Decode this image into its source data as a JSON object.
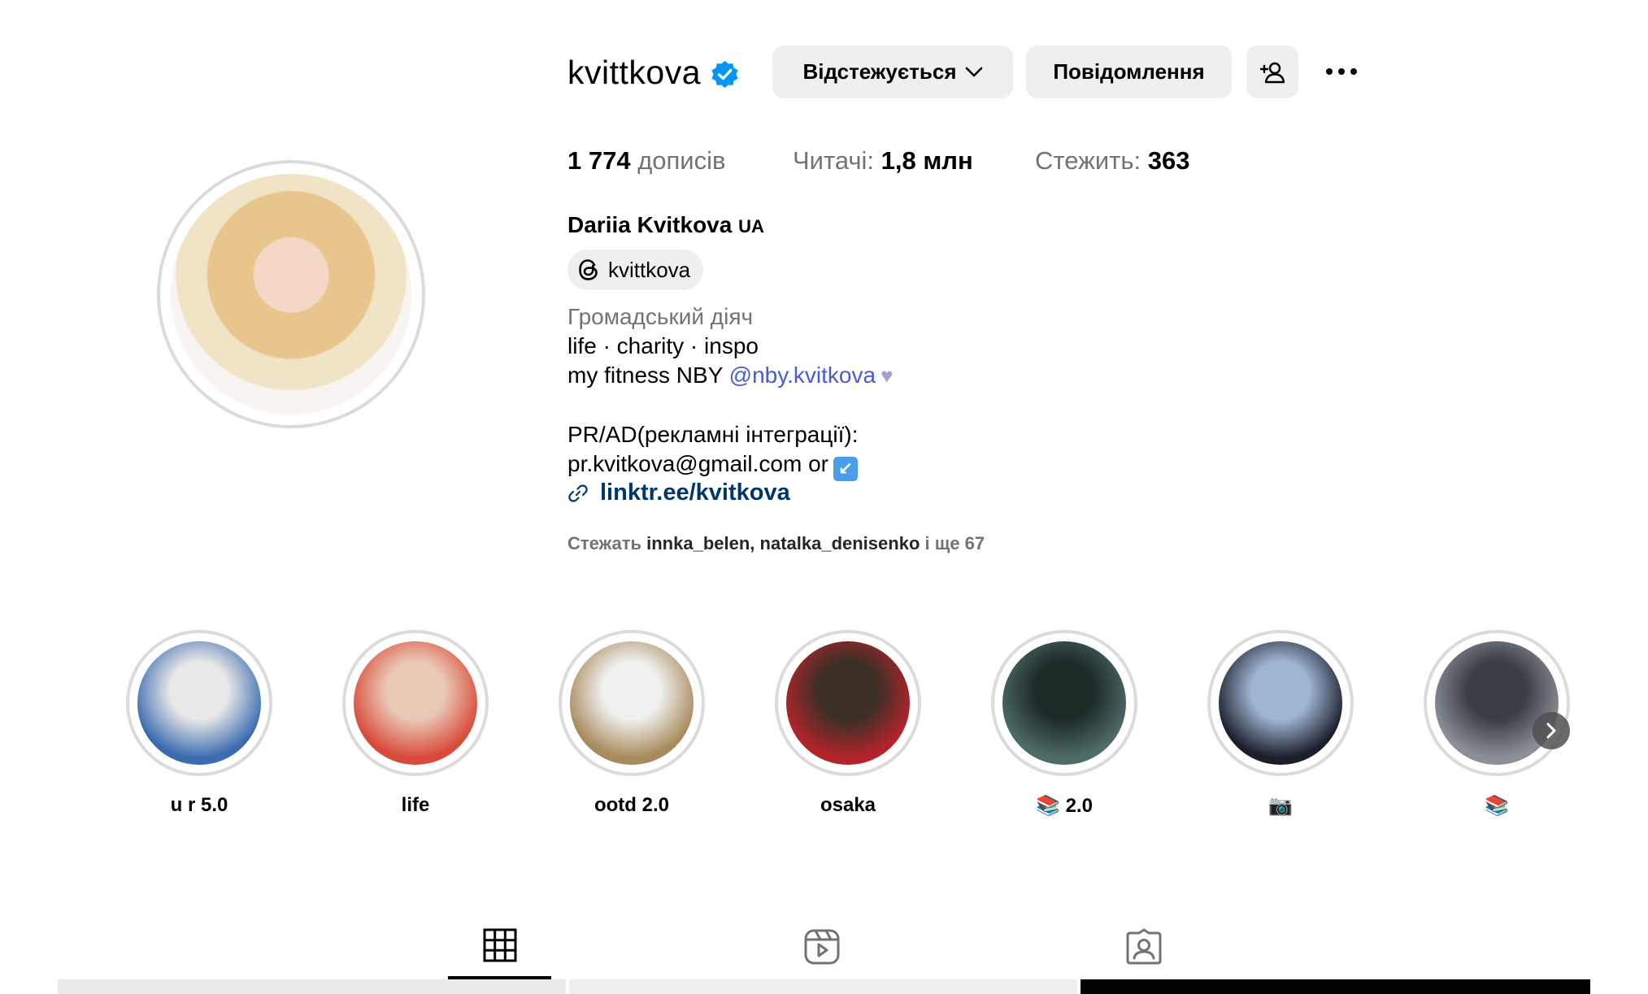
{
  "header": {
    "username": "kvittkova",
    "follow_button": "Відстежується",
    "message_button": "Повідомлення"
  },
  "stats": {
    "posts_count": "1 774",
    "posts_label": " дописів",
    "followers_label": "Читачі: ",
    "followers_count": "1,8 млн",
    "following_label": "Стежить: ",
    "following_count": "363"
  },
  "bio": {
    "full_name": "Dariia Kvitkova ",
    "flag": "UA",
    "threads_handle": "kvittkova",
    "category": "Громадський діяч",
    "line1": "life · charity · inspo",
    "line2_text": "my fitness NBY ",
    "line2_mention": "@nby.kvitkova",
    "line3": "PR/AD(рекламні інтеграції):",
    "line4": "pr.kvitkova@gmail.com or",
    "link": "linktr.ee/kvitkova",
    "followed_by_prefix": "Стежать ",
    "followed_by_user1": "innka_belen",
    "followed_by_sep": ", ",
    "followed_by_user2": "natalka_denisenko",
    "followed_by_suffix": " і ще 67"
  },
  "highlights": [
    {
      "label": "u r 5.0",
      "color1": "#3c6cb0",
      "color2": "#e8e8e8"
    },
    {
      "label": "life",
      "color1": "#d94a3a",
      "color2": "#e9c9b5"
    },
    {
      "label": "ootd 2.0",
      "color1": "#a88a5c",
      "color2": "#f0f0ee"
    },
    {
      "label": "osaka",
      "color1": "#b3242a",
      "color2": "#3a3026"
    },
    {
      "label": "📚 2.0",
      "color1": "#4d6b67",
      "color2": "#1d2a28"
    },
    {
      "label": "📷",
      "color1": "#1b1f2b",
      "color2": "#9fb6d3"
    },
    {
      "label": "📚",
      "color1": "#8b8f97",
      "color2": "#3a3e45"
    }
  ],
  "colors": {
    "verified": "#0095f6",
    "link": "#00376b",
    "mention": "#4a5bd4",
    "button_bg": "#efefef",
    "muted": "#737373"
  },
  "icons": [
    "verified-badge-icon",
    "chevron-down-icon",
    "add-person-icon",
    "more-options-icon",
    "threads-icon",
    "link-icon",
    "chevron-right-icon",
    "grid-icon",
    "reels-icon",
    "tagged-icon"
  ]
}
